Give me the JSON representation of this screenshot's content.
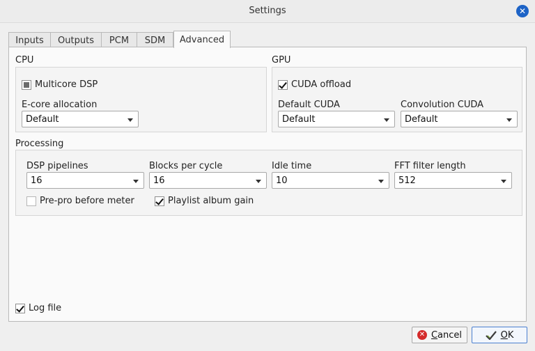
{
  "window": {
    "title": "Settings"
  },
  "tabs": [
    {
      "label": "Inputs"
    },
    {
      "label": "Outputs"
    },
    {
      "label": "PCM"
    },
    {
      "label": "SDM"
    },
    {
      "label": "Advanced"
    }
  ],
  "active_tab": "Advanced",
  "cpu": {
    "heading": "CPU",
    "multicore": {
      "label": "Multicore DSP",
      "state": "partial"
    },
    "ecore": {
      "label": "E-core allocation",
      "value": "Default"
    }
  },
  "gpu": {
    "heading": "GPU",
    "cuda_offload": {
      "label": "CUDA offload",
      "checked": true
    },
    "default_cuda": {
      "label": "Default CUDA",
      "value": "Default"
    },
    "convolution_cuda": {
      "label": "Convolution CUDA",
      "value": "Default"
    }
  },
  "processing": {
    "heading": "Processing",
    "dsp_pipelines": {
      "label": "DSP pipelines",
      "value": "16"
    },
    "blocks_per_cycle": {
      "label": "Blocks per cycle",
      "value": "16"
    },
    "idle_time": {
      "label": "Idle time",
      "value": "10"
    },
    "fft_filter_length": {
      "label": "FFT filter length",
      "value": "512"
    },
    "prepro_meter": {
      "label": "Pre-pro before meter",
      "checked": false
    },
    "playlist_gain": {
      "label": "Playlist album gain",
      "checked": true
    }
  },
  "log_file": {
    "label": "Log file",
    "checked": true
  },
  "buttons": {
    "cancel_first": "C",
    "cancel_rest": "ancel",
    "ok_first": "O",
    "ok_rest": "K"
  }
}
